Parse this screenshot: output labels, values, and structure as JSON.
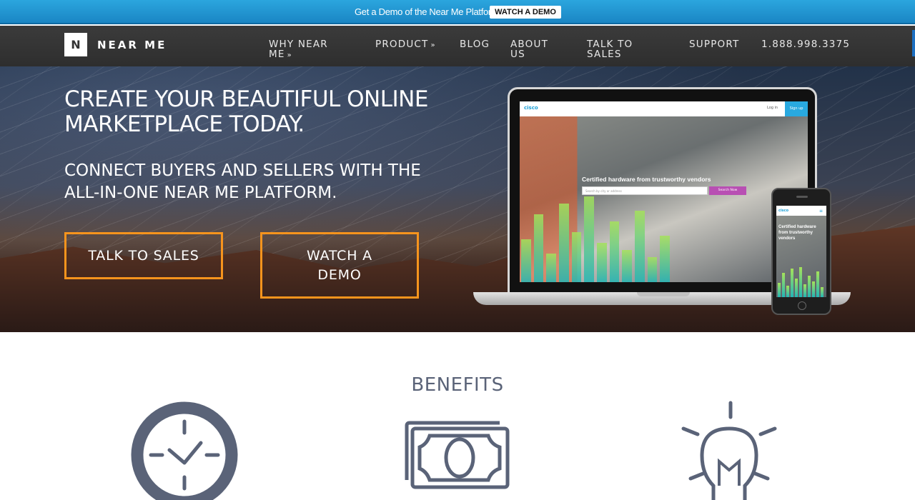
{
  "topbar": {
    "text": "Get a Demo of the Near Me Platform",
    "button": "WATCH A DEMO"
  },
  "nav": {
    "logo_letter": "N",
    "logo_text": "NEAR ME",
    "items": [
      {
        "label": "WHY NEAR ME",
        "dropdown": true
      },
      {
        "label": "PRODUCT",
        "dropdown": true
      },
      {
        "label": "BLOG",
        "dropdown": false
      },
      {
        "label": "ABOUT US",
        "dropdown": false
      },
      {
        "label": "TALK TO SALES",
        "dropdown": false
      },
      {
        "label": "SUPPORT",
        "dropdown": false
      },
      {
        "label": "1.888.998.3375",
        "dropdown": false
      }
    ]
  },
  "hero": {
    "title": "CREATE YOUR BEAUTIFUL ONLINE MARKETPLACE TODAY.",
    "subtitle": "CONNECT BUYERS AND SELLERS WITH THE ALL-IN-ONE NEAR ME PLATFORM.",
    "cta_sales": "TALK TO SALES",
    "cta_demo": "WATCH A DEMO",
    "mockup": {
      "logo": "cisco",
      "login": "Log in",
      "signup": "Sign up",
      "headline": "Certified hardware from trustworthy vendors",
      "search_placeholder": "Search by city or address",
      "search_button": "Search Now",
      "phone_headline": "Certified hardware from trustworthy vendors",
      "phone_menu_icon": "menu-icon"
    }
  },
  "benefits": {
    "title": "BENEFITS",
    "icons": [
      "clock-icon",
      "money-icon",
      "lightbulb-icon"
    ]
  },
  "colors": {
    "topbar": "#1f95d2",
    "nav": "#353535",
    "accent": "#f7941d",
    "icon_gray": "#5a6378"
  }
}
